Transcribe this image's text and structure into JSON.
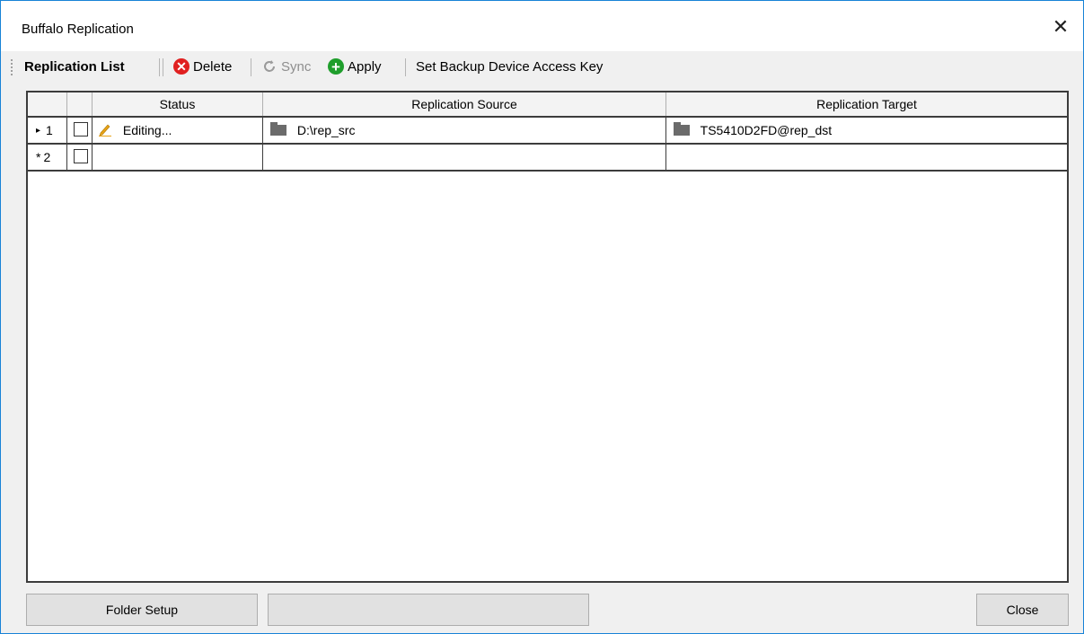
{
  "window": {
    "title": "Buffalo Replication",
    "close_glyph": "✕"
  },
  "toolbar": {
    "replication_list_label": "Replication List",
    "delete_label": "Delete",
    "sync_label": "Sync",
    "apply_label": "Apply",
    "set_key_label": "Set Backup Device Access Key",
    "icons": {
      "delete": "delete-icon",
      "sync": "sync-icon",
      "apply": "add-icon"
    },
    "colors": {
      "delete": "#e02020",
      "apply": "#1f9e2c",
      "sync_disabled": "#9a9a9a"
    }
  },
  "grid": {
    "columns": [
      "Status",
      "Replication Source",
      "Replication Target"
    ],
    "rows": [
      {
        "row_marker": "▸",
        "number": "1",
        "status": "Editing...",
        "source": "D:\\rep_src",
        "target": "TS5410D2FD@rep_dst"
      },
      {
        "row_marker": "*",
        "number": "2",
        "status": "",
        "source": "",
        "target": ""
      }
    ]
  },
  "footer": {
    "folder_setup_label": "Folder Setup",
    "blank_button_label": "",
    "close_label": "Close"
  }
}
